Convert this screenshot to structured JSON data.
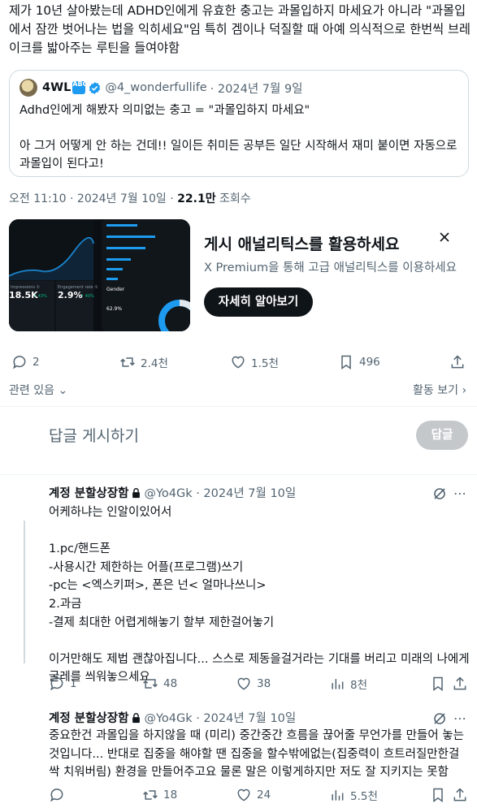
{
  "main_post": {
    "text": "제가 10년 살아봤는데 ADHD인에게 유효한 충고는 과몰입하지 마세요가 아니라 \"과몰입에서 잠깐 벗어나는 법을 익히세요\"임 특히 겜이나 덕질할 때 아예 의식적으로 한번씩 브레이크를 밟아주는 루틴을 들여야함"
  },
  "quote": {
    "name": "4WL",
    "badge": "ABCD",
    "handle": "@4_wonderfullife",
    "date": "· 2024년 7월 9일",
    "text": "Adhd인에게 해봤자 의미없는 충고 = \"과몰입하지 마세요\"\n\n아 그거 어떻게 안 하는 건데!! 일이든 취미든 공부든 일단 시작해서 재미 붙이면 자동으로 과몰입이 된다고!"
  },
  "meta": {
    "time": "오전 11:10 · 2024년 7월 10일 · ",
    "views": "22.1만",
    "views_label": " 조회수"
  },
  "promo": {
    "title": "게시 애널리틱스를 활용하세요",
    "subtitle": "X Premium을 통해 고급 애널리틱스를 이용하세요",
    "button": "자세히 알아보기",
    "img": {
      "stat1": "18.5K",
      "stat1_label": "Impressions ①",
      "stat1_delta": "↑ 43%",
      "stat2": "2.9%",
      "stat2_label": "Engagement rate ①",
      "stat2_delta": "↑ 40%",
      "gender": "Gender",
      "pct": "62.9%"
    }
  },
  "actions": {
    "replies": "2",
    "reposts": "2.4천",
    "likes": "1.5천",
    "bookmarks": "496"
  },
  "related": "관련 있음",
  "activity": "활동 보기",
  "reply_placeholder": "답글 게시하기",
  "reply_button": "답글",
  "replies": [
    {
      "name": "계정 분할상장함",
      "handle": "@Yo4Gk · 2024년 7월 10일",
      "text": "어케하냐는 인알이있어서\n\n1.pc/핸드폰\n-사용시간 제한하는 어플(프로그램)쓰기\n-pc는 <엑스키퍼>, 폰은 넌< 얼마나쓰니>\n2.과금\n-결제 최대한 어렵게해놓기  할부 제한걸어놓기\n\n이거만해도 제법 괜찮아집니다... 스스로 제동을걸거라는 기대를 버리고 미래의 나에게 굴레를 씌워놓으세요",
      "replies": "1",
      "reposts": "48",
      "likes": "38",
      "views": "8천"
    },
    {
      "name": "계정 분할상장함",
      "handle": "@Yo4Gk · 2024년 7월 10일",
      "text": "중요한건 과몰입을 하지않을 때 (미리) 중간중간 흐름을 끊어줄 무언가를 만들어 놓는것입니다... 반대로 집중을 해야할 땐 집중을 할수밖에없는(집중력이 흐트러질만한걸 싹 치워버림) 환경을 만들어주고요 물론 말은 이렇게하지만 저도 잘 지키지는 못함",
      "replies": "",
      "reposts": "18",
      "likes": "24",
      "views": "5.5천"
    }
  ]
}
